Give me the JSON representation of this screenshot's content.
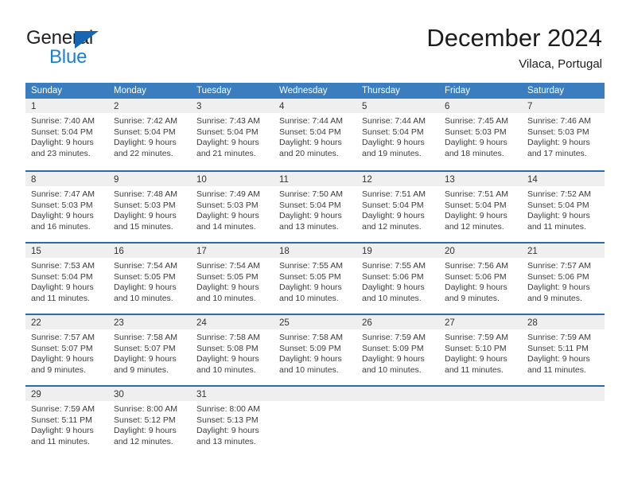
{
  "brand": {
    "name_part1": "General",
    "name_part2": "Blue",
    "triangle_color": "#1567b3",
    "blue_color": "#1b7fd4"
  },
  "header": {
    "title": "December 2024",
    "subtitle": "Vilaca, Portugal"
  },
  "theme": {
    "header_row_bg": "#3a7ebf",
    "week_divider": "#2c6aa8",
    "day_band_bg": "#efefef",
    "text": "#3b3b3b"
  },
  "weekdays": [
    "Sunday",
    "Monday",
    "Tuesday",
    "Wednesday",
    "Thursday",
    "Friday",
    "Saturday"
  ],
  "weeks": [
    [
      {
        "day": "1",
        "sunrise": "Sunrise: 7:40 AM",
        "sunset": "Sunset: 5:04 PM",
        "daylight1": "Daylight: 9 hours",
        "daylight2": "and 23 minutes."
      },
      {
        "day": "2",
        "sunrise": "Sunrise: 7:42 AM",
        "sunset": "Sunset: 5:04 PM",
        "daylight1": "Daylight: 9 hours",
        "daylight2": "and 22 minutes."
      },
      {
        "day": "3",
        "sunrise": "Sunrise: 7:43 AM",
        "sunset": "Sunset: 5:04 PM",
        "daylight1": "Daylight: 9 hours",
        "daylight2": "and 21 minutes."
      },
      {
        "day": "4",
        "sunrise": "Sunrise: 7:44 AM",
        "sunset": "Sunset: 5:04 PM",
        "daylight1": "Daylight: 9 hours",
        "daylight2": "and 20 minutes."
      },
      {
        "day": "5",
        "sunrise": "Sunrise: 7:44 AM",
        "sunset": "Sunset: 5:04 PM",
        "daylight1": "Daylight: 9 hours",
        "daylight2": "and 19 minutes."
      },
      {
        "day": "6",
        "sunrise": "Sunrise: 7:45 AM",
        "sunset": "Sunset: 5:03 PM",
        "daylight1": "Daylight: 9 hours",
        "daylight2": "and 18 minutes."
      },
      {
        "day": "7",
        "sunrise": "Sunrise: 7:46 AM",
        "sunset": "Sunset: 5:03 PM",
        "daylight1": "Daylight: 9 hours",
        "daylight2": "and 17 minutes."
      }
    ],
    [
      {
        "day": "8",
        "sunrise": "Sunrise: 7:47 AM",
        "sunset": "Sunset: 5:03 PM",
        "daylight1": "Daylight: 9 hours",
        "daylight2": "and 16 minutes."
      },
      {
        "day": "9",
        "sunrise": "Sunrise: 7:48 AM",
        "sunset": "Sunset: 5:03 PM",
        "daylight1": "Daylight: 9 hours",
        "daylight2": "and 15 minutes."
      },
      {
        "day": "10",
        "sunrise": "Sunrise: 7:49 AM",
        "sunset": "Sunset: 5:03 PM",
        "daylight1": "Daylight: 9 hours",
        "daylight2": "and 14 minutes."
      },
      {
        "day": "11",
        "sunrise": "Sunrise: 7:50 AM",
        "sunset": "Sunset: 5:04 PM",
        "daylight1": "Daylight: 9 hours",
        "daylight2": "and 13 minutes."
      },
      {
        "day": "12",
        "sunrise": "Sunrise: 7:51 AM",
        "sunset": "Sunset: 5:04 PM",
        "daylight1": "Daylight: 9 hours",
        "daylight2": "and 12 minutes."
      },
      {
        "day": "13",
        "sunrise": "Sunrise: 7:51 AM",
        "sunset": "Sunset: 5:04 PM",
        "daylight1": "Daylight: 9 hours",
        "daylight2": "and 12 minutes."
      },
      {
        "day": "14",
        "sunrise": "Sunrise: 7:52 AM",
        "sunset": "Sunset: 5:04 PM",
        "daylight1": "Daylight: 9 hours",
        "daylight2": "and 11 minutes."
      }
    ],
    [
      {
        "day": "15",
        "sunrise": "Sunrise: 7:53 AM",
        "sunset": "Sunset: 5:04 PM",
        "daylight1": "Daylight: 9 hours",
        "daylight2": "and 11 minutes."
      },
      {
        "day": "16",
        "sunrise": "Sunrise: 7:54 AM",
        "sunset": "Sunset: 5:05 PM",
        "daylight1": "Daylight: 9 hours",
        "daylight2": "and 10 minutes."
      },
      {
        "day": "17",
        "sunrise": "Sunrise: 7:54 AM",
        "sunset": "Sunset: 5:05 PM",
        "daylight1": "Daylight: 9 hours",
        "daylight2": "and 10 minutes."
      },
      {
        "day": "18",
        "sunrise": "Sunrise: 7:55 AM",
        "sunset": "Sunset: 5:05 PM",
        "daylight1": "Daylight: 9 hours",
        "daylight2": "and 10 minutes."
      },
      {
        "day": "19",
        "sunrise": "Sunrise: 7:55 AM",
        "sunset": "Sunset: 5:06 PM",
        "daylight1": "Daylight: 9 hours",
        "daylight2": "and 10 minutes."
      },
      {
        "day": "20",
        "sunrise": "Sunrise: 7:56 AM",
        "sunset": "Sunset: 5:06 PM",
        "daylight1": "Daylight: 9 hours",
        "daylight2": "and 9 minutes."
      },
      {
        "day": "21",
        "sunrise": "Sunrise: 7:57 AM",
        "sunset": "Sunset: 5:06 PM",
        "daylight1": "Daylight: 9 hours",
        "daylight2": "and 9 minutes."
      }
    ],
    [
      {
        "day": "22",
        "sunrise": "Sunrise: 7:57 AM",
        "sunset": "Sunset: 5:07 PM",
        "daylight1": "Daylight: 9 hours",
        "daylight2": "and 9 minutes."
      },
      {
        "day": "23",
        "sunrise": "Sunrise: 7:58 AM",
        "sunset": "Sunset: 5:07 PM",
        "daylight1": "Daylight: 9 hours",
        "daylight2": "and 9 minutes."
      },
      {
        "day": "24",
        "sunrise": "Sunrise: 7:58 AM",
        "sunset": "Sunset: 5:08 PM",
        "daylight1": "Daylight: 9 hours",
        "daylight2": "and 10 minutes."
      },
      {
        "day": "25",
        "sunrise": "Sunrise: 7:58 AM",
        "sunset": "Sunset: 5:09 PM",
        "daylight1": "Daylight: 9 hours",
        "daylight2": "and 10 minutes."
      },
      {
        "day": "26",
        "sunrise": "Sunrise: 7:59 AM",
        "sunset": "Sunset: 5:09 PM",
        "daylight1": "Daylight: 9 hours",
        "daylight2": "and 10 minutes."
      },
      {
        "day": "27",
        "sunrise": "Sunrise: 7:59 AM",
        "sunset": "Sunset: 5:10 PM",
        "daylight1": "Daylight: 9 hours",
        "daylight2": "and 11 minutes."
      },
      {
        "day": "28",
        "sunrise": "Sunrise: 7:59 AM",
        "sunset": "Sunset: 5:11 PM",
        "daylight1": "Daylight: 9 hours",
        "daylight2": "and 11 minutes."
      }
    ],
    [
      {
        "day": "29",
        "sunrise": "Sunrise: 7:59 AM",
        "sunset": "Sunset: 5:11 PM",
        "daylight1": "Daylight: 9 hours",
        "daylight2": "and 11 minutes."
      },
      {
        "day": "30",
        "sunrise": "Sunrise: 8:00 AM",
        "sunset": "Sunset: 5:12 PM",
        "daylight1": "Daylight: 9 hours",
        "daylight2": "and 12 minutes."
      },
      {
        "day": "31",
        "sunrise": "Sunrise: 8:00 AM",
        "sunset": "Sunset: 5:13 PM",
        "daylight1": "Daylight: 9 hours",
        "daylight2": "and 13 minutes."
      },
      {
        "day": "",
        "sunrise": "",
        "sunset": "",
        "daylight1": "",
        "daylight2": ""
      },
      {
        "day": "",
        "sunrise": "",
        "sunset": "",
        "daylight1": "",
        "daylight2": ""
      },
      {
        "day": "",
        "sunrise": "",
        "sunset": "",
        "daylight1": "",
        "daylight2": ""
      },
      {
        "day": "",
        "sunrise": "",
        "sunset": "",
        "daylight1": "",
        "daylight2": ""
      }
    ]
  ]
}
